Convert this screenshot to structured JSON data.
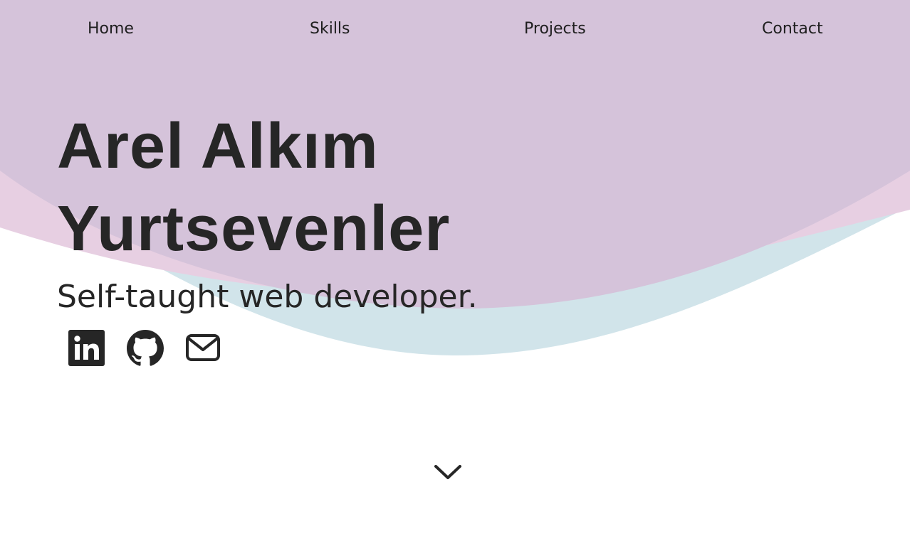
{
  "nav": {
    "items": [
      {
        "label": "Home"
      },
      {
        "label": "Skills"
      },
      {
        "label": "Projects"
      },
      {
        "label": "Contact"
      }
    ]
  },
  "hero": {
    "name_line1": "Arel Alkım",
    "name_line2": "Yurtsevenler",
    "tagline": "Self-taught web developer."
  },
  "socials": [
    {
      "icon": "linkedin-icon"
    },
    {
      "icon": "github-icon"
    },
    {
      "icon": "mail-icon"
    }
  ],
  "scroll": {
    "icon": "chevron-down-icon"
  },
  "colors": {
    "blob_purple": "#d5c3da",
    "blob_pink": "#e7cfe2",
    "blob_blue": "#d1e4ea",
    "text": "#262626",
    "background": "#ffffff"
  }
}
